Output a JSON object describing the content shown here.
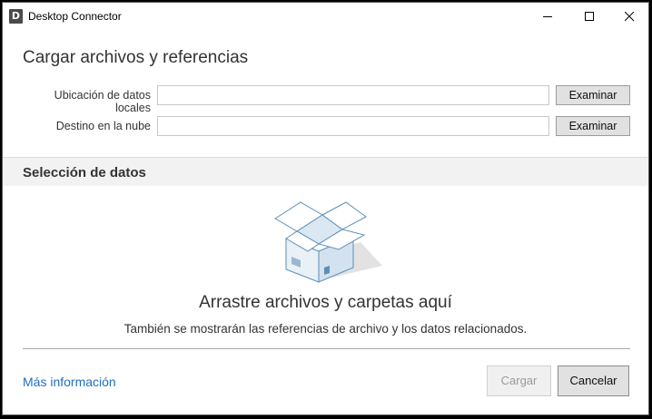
{
  "window": {
    "title": "Desktop Connector",
    "icon_letter": "D"
  },
  "header": {
    "title": "Cargar archivos y referencias"
  },
  "form": {
    "local_label": "Ubicación de datos locales",
    "local_value": "",
    "cloud_label": "Destino en la nube",
    "cloud_value": "",
    "browse_label": "Examinar"
  },
  "section": {
    "title": "Selección de datos"
  },
  "dropzone": {
    "title": "Arrastre archivos y carpetas aquí",
    "subtitle": "También se mostrarán las referencias de archivo y los datos relacionados."
  },
  "footer": {
    "more_info": "Más información",
    "upload_label": "Cargar",
    "cancel_label": "Cancelar"
  },
  "colors": {
    "link": "#1f6fbf",
    "section_band": "#f2f2f2",
    "button_face": "#e1e1e1"
  }
}
